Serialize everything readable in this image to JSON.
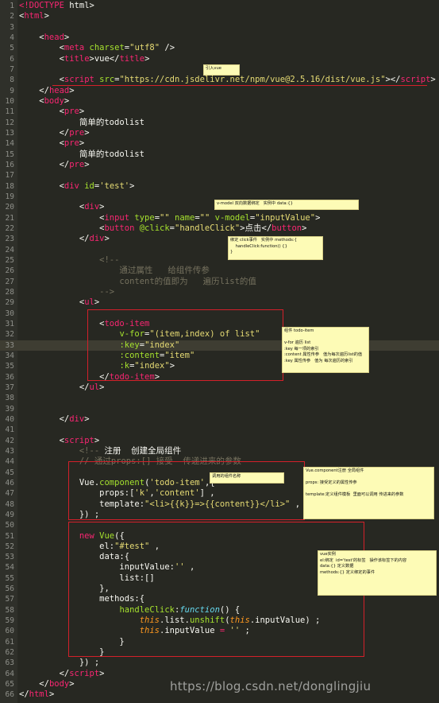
{
  "editor": {
    "current_line": 32,
    "lines": [
      {
        "n": "1",
        "s": [
          [
            "t",
            "<!DOCTYPE"
          ],
          [
            "p",
            " html>"
          ]
        ]
      },
      {
        "n": "2",
        "s": [
          [
            "p",
            "<"
          ],
          [
            "t",
            "html"
          ],
          [
            "p",
            ">"
          ]
        ]
      },
      {
        "n": "3",
        "s": []
      },
      {
        "n": "4",
        "s": [
          [
            "p",
            "    <"
          ],
          [
            "t",
            "head"
          ],
          [
            "p",
            ">"
          ]
        ]
      },
      {
        "n": "5",
        "s": [
          [
            "p",
            "        <"
          ],
          [
            "t",
            "meta"
          ],
          [
            "p",
            " "
          ],
          [
            "a",
            "charset"
          ],
          [
            "p",
            "="
          ],
          [
            "s",
            "\"utf8\""
          ],
          [
            "p",
            " />"
          ]
        ]
      },
      {
        "n": "6",
        "s": [
          [
            "p",
            "        <"
          ],
          [
            "t",
            "title"
          ],
          [
            "p",
            ">vue</"
          ],
          [
            "t",
            "title"
          ],
          [
            "p",
            ">"
          ]
        ]
      },
      {
        "n": "7",
        "s": []
      },
      {
        "n": "8",
        "s": [
          [
            "p",
            "        <"
          ],
          [
            "t",
            "script"
          ],
          [
            "p",
            " "
          ],
          [
            "a",
            "src"
          ],
          [
            "p",
            "="
          ],
          [
            "s",
            "\"https://cdn.jsdelivr.net/npm/vue@2.5.16/dist/vue.js\""
          ],
          [
            "p",
            "></"
          ],
          [
            "t",
            "script"
          ],
          [
            "p",
            ">"
          ]
        ]
      },
      {
        "n": "9",
        "s": [
          [
            "p",
            "    </"
          ],
          [
            "t",
            "head"
          ],
          [
            "p",
            ">"
          ]
        ]
      },
      {
        "n": "10",
        "s": [
          [
            "p",
            "    <"
          ],
          [
            "t",
            "body"
          ],
          [
            "p",
            ">"
          ]
        ]
      },
      {
        "n": "11",
        "s": [
          [
            "p",
            "        <"
          ],
          [
            "t",
            "pre"
          ],
          [
            "p",
            ">"
          ]
        ]
      },
      {
        "n": "12",
        "s": [
          [
            "p",
            "            简单的todolist"
          ]
        ]
      },
      {
        "n": "13",
        "s": [
          [
            "p",
            "        </"
          ],
          [
            "t",
            "pre"
          ],
          [
            "p",
            ">"
          ]
        ]
      },
      {
        "n": "14",
        "s": [
          [
            "p",
            "        <"
          ],
          [
            "t",
            "pre"
          ],
          [
            "p",
            ">"
          ]
        ]
      },
      {
        "n": "15",
        "s": [
          [
            "p",
            "            简单的todolist"
          ]
        ]
      },
      {
        "n": "16",
        "s": [
          [
            "p",
            "        </"
          ],
          [
            "t",
            "pre"
          ],
          [
            "p",
            ">"
          ]
        ]
      },
      {
        "n": "17",
        "s": []
      },
      {
        "n": "17",
        "s": [
          [
            "p",
            "        <"
          ],
          [
            "t",
            "div"
          ],
          [
            "p",
            " "
          ],
          [
            "a",
            "id"
          ],
          [
            "p",
            "="
          ],
          [
            "s",
            "'test'"
          ],
          [
            "p",
            ">"
          ]
        ]
      },
      {
        "n": "17",
        "s": []
      },
      {
        "n": "18",
        "s": [
          [
            "p",
            "            <"
          ],
          [
            "t",
            "div"
          ],
          [
            "p",
            ">"
          ]
        ]
      },
      {
        "n": "19",
        "s": [
          [
            "p",
            "                <"
          ],
          [
            "t",
            "input"
          ],
          [
            "p",
            " "
          ],
          [
            "a",
            "type"
          ],
          [
            "p",
            "="
          ],
          [
            "s",
            "\"\""
          ],
          [
            "p",
            " "
          ],
          [
            "a",
            "name"
          ],
          [
            "p",
            "="
          ],
          [
            "s",
            "\"\""
          ],
          [
            "p",
            " "
          ],
          [
            "a",
            "v-model"
          ],
          [
            "p",
            "="
          ],
          [
            "s",
            "\"inputValue\""
          ],
          [
            "p",
            ">"
          ]
        ]
      },
      {
        "n": "20",
        "s": [
          [
            "p",
            "                <"
          ],
          [
            "t",
            "button"
          ],
          [
            "p",
            " "
          ],
          [
            "a",
            "@click"
          ],
          [
            "p",
            "="
          ],
          [
            "s",
            "\"handleClick\""
          ],
          [
            "p",
            ">点击</"
          ],
          [
            "t",
            "button"
          ],
          [
            "p",
            ">"
          ]
        ]
      },
      {
        "n": "21",
        "s": [
          [
            "p",
            "            </"
          ],
          [
            "t",
            "div"
          ],
          [
            "p",
            ">"
          ]
        ]
      },
      {
        "n": "22",
        "s": []
      },
      {
        "n": "23",
        "s": [
          [
            "c",
            "                <!--"
          ]
        ]
      },
      {
        "n": "24",
        "s": [
          [
            "c",
            "                    通过属性   给组件传参"
          ]
        ]
      },
      {
        "n": "25",
        "s": [
          [
            "c",
            "                    content的值即为   遍历list的值"
          ]
        ]
      },
      {
        "n": "26",
        "s": [
          [
            "c",
            "                -->"
          ]
        ]
      },
      {
        "n": "27",
        "s": [
          [
            "p",
            "            <"
          ],
          [
            "t",
            "ul"
          ],
          [
            "p",
            ">"
          ]
        ]
      },
      {
        "n": "28",
        "s": []
      },
      {
        "n": "29",
        "s": [
          [
            "p",
            "                <"
          ],
          [
            "t",
            "todo-item"
          ]
        ]
      },
      {
        "n": "29",
        "s": [
          [
            "p",
            "                    "
          ],
          [
            "a",
            "v-for"
          ],
          [
            "p",
            "="
          ],
          [
            "s",
            "\"(item,index) of list\""
          ]
        ]
      },
      {
        "n": "30",
        "s": [
          [
            "p",
            "                    "
          ],
          [
            "a",
            ":key"
          ],
          [
            "p",
            "="
          ],
          [
            "s",
            "\"index\""
          ]
        ]
      },
      {
        "n": "31",
        "s": [
          [
            "p",
            "                    "
          ],
          [
            "a",
            ":content"
          ],
          [
            "p",
            "="
          ],
          [
            "s",
            "\"item\""
          ]
        ]
      },
      {
        "n": "32",
        "s": [
          [
            "p",
            "                    "
          ],
          [
            "a",
            ":k"
          ],
          [
            "p",
            "="
          ],
          [
            "s",
            "\"index\""
          ],
          [
            "p",
            ">"
          ]
        ]
      },
      {
        "n": "33",
        "s": [
          [
            "p",
            "                </"
          ],
          [
            "t",
            "todo-item"
          ],
          [
            "p",
            ">"
          ]
        ]
      },
      {
        "n": "34",
        "s": [
          [
            "p",
            "            </"
          ],
          [
            "t",
            "ul"
          ],
          [
            "p",
            ">"
          ]
        ]
      },
      {
        "n": "35",
        "s": []
      },
      {
        "n": "36",
        "s": []
      },
      {
        "n": "37",
        "s": [
          [
            "p",
            "        </"
          ],
          [
            "t",
            "div"
          ],
          [
            "p",
            ">"
          ]
        ]
      },
      {
        "n": "38",
        "s": []
      },
      {
        "n": "39",
        "s": [
          [
            "p",
            "        <"
          ],
          [
            "t",
            "script"
          ],
          [
            "p",
            ">"
          ]
        ]
      },
      {
        "n": "40",
        "s": [
          [
            "c",
            "            <!-- "
          ],
          [
            "p",
            "注册  创建全局组件"
          ]
        ]
      },
      {
        "n": "41",
        "s": [
          [
            "c",
            "            // 通过props:[] 接受  传递进来的参数"
          ]
        ]
      },
      {
        "n": "42",
        "s": []
      },
      {
        "n": "43",
        "s": [
          [
            "p",
            "            Vue."
          ],
          [
            "fn",
            "component"
          ],
          [
            "p",
            "("
          ],
          [
            "s",
            "'todo-item'"
          ],
          [
            "p",
            ",{"
          ]
        ]
      },
      {
        "n": "44",
        "s": [
          [
            "p",
            "                props:["
          ],
          [
            "s",
            "'k'"
          ],
          [
            "p",
            ","
          ],
          [
            "s",
            "'content'"
          ],
          [
            "p",
            "] ,"
          ]
        ]
      },
      {
        "n": "45",
        "s": [
          [
            "p",
            "                template:"
          ],
          [
            "s",
            "\"<li>{{k}}=>{{content}}</li>\""
          ],
          [
            "p",
            " ,"
          ]
        ]
      },
      {
        "n": "46",
        "s": [
          [
            "p",
            "            }) ;"
          ]
        ]
      },
      {
        "n": "47",
        "s": []
      },
      {
        "n": "48",
        "s": [
          [
            "p",
            "            "
          ],
          [
            "t",
            "new"
          ],
          [
            "p",
            " "
          ],
          [
            "fn",
            "Vue"
          ],
          [
            "p",
            "({"
          ]
        ]
      },
      {
        "n": "49",
        "s": [
          [
            "p",
            "                el:"
          ],
          [
            "s",
            "\"#test\""
          ],
          [
            "p",
            " ,"
          ]
        ]
      },
      {
        "n": "50",
        "s": [
          [
            "p",
            "                data:{"
          ]
        ]
      },
      {
        "n": "51",
        "s": [
          [
            "p",
            "                    inputValue:"
          ],
          [
            "s",
            "''"
          ],
          [
            "p",
            " ,"
          ]
        ]
      },
      {
        "n": "52",
        "s": [
          [
            "p",
            "                    list:[]"
          ]
        ]
      },
      {
        "n": "53",
        "s": [
          [
            "p",
            "                },"
          ]
        ]
      },
      {
        "n": "54",
        "s": [
          [
            "p",
            "                methods:{"
          ]
        ]
      },
      {
        "n": "55",
        "s": [
          [
            "p",
            "                    "
          ],
          [
            "fn",
            "handleClick"
          ],
          [
            "p",
            ":"
          ],
          [
            "k",
            "function"
          ],
          [
            "p",
            "() {"
          ]
        ]
      },
      {
        "n": "56",
        "s": [
          [
            "p",
            "                        "
          ],
          [
            "th",
            "this"
          ],
          [
            "p",
            ".list."
          ],
          [
            "fn",
            "unshift"
          ],
          [
            "p",
            "("
          ],
          [
            "th",
            "this"
          ],
          [
            "p",
            ".inputValue) ;"
          ]
        ]
      },
      {
        "n": "57",
        "s": [
          [
            "p",
            "                        "
          ],
          [
            "th",
            "this"
          ],
          [
            "p",
            ".inputValue "
          ],
          [
            "t",
            "="
          ],
          [
            "p",
            " "
          ],
          [
            "s",
            "''"
          ],
          [
            "p",
            " ;"
          ]
        ]
      },
      {
        "n": "58",
        "s": [
          [
            "p",
            "                    }"
          ]
        ]
      },
      {
        "n": "59",
        "s": [
          [
            "p",
            "                }"
          ]
        ]
      },
      {
        "n": "60",
        "s": [
          [
            "p",
            "            }) ;"
          ]
        ]
      },
      {
        "n": "61",
        "s": [
          [
            "p",
            "        </"
          ],
          [
            "t",
            "script"
          ],
          [
            "p",
            ">"
          ]
        ]
      },
      {
        "n": "62",
        "s": [
          [
            "p",
            "    </"
          ],
          [
            "t",
            "body"
          ],
          [
            "p",
            ">"
          ]
        ]
      },
      {
        "n": "63",
        "s": [
          [
            "p",
            "</"
          ],
          [
            "t",
            "html"
          ],
          [
            "p",
            ">"
          ]
        ]
      }
    ]
  },
  "annotations": {
    "vue_cdn": "引入vue",
    "v_model": "v-model 双向数据绑定   实例中 data:{}",
    "click": "绑定 click事件   实例中 methods:{\n    handleClick:function() {}\n}",
    "todo_item": "组件 todo-item\n\nv-for 遍历 list\n:key 每一项的索引\n:content 属性传参   值为每次遍历list的值\n:key 属性传参   值为 每次遍历的索引",
    "component_name": "调用的组件名称",
    "component": "Vue.component注册 全局组件\n\nprops: 接受定义的属性传参\n\ntemplate:定义组件模板  里面可以调用 传进来的参数",
    "instance": "vue实例\nel:绑定  id='test'的标签   操作该标签下的内容\ndata:{} 定义数据\nmethods:{} 定义绑定的事件"
  },
  "watermark": "https://blog.csdn.net/donglingjiu"
}
